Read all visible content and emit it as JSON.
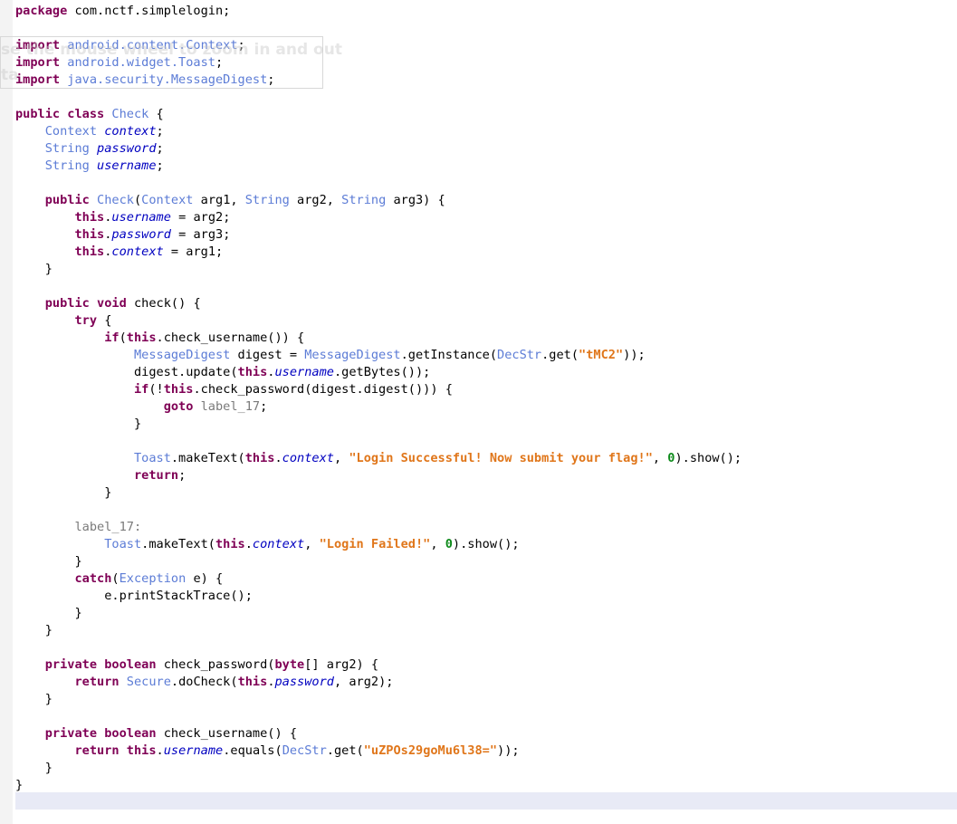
{
  "editor": {
    "tooltip": {
      "line1": "se the mouse wheel to zoom in and out",
      "line2": "ta"
    },
    "lines": [
      [
        {
          "t": "kw",
          "v": "package"
        },
        {
          "t": "plain",
          "v": " com.nctf.simplelogin;"
        }
      ],
      [],
      [
        {
          "t": "kw",
          "v": "import"
        },
        {
          "t": "type",
          "v": " android.content.Context"
        },
        {
          "t": "plain",
          "v": ";"
        }
      ],
      [
        {
          "t": "kw",
          "v": "import"
        },
        {
          "t": "type",
          "v": " android.widget.Toast"
        },
        {
          "t": "plain",
          "v": ";"
        }
      ],
      [
        {
          "t": "kw",
          "v": "import"
        },
        {
          "t": "type",
          "v": " java.security.MessageDigest"
        },
        {
          "t": "plain",
          "v": ";"
        }
      ],
      [],
      [
        {
          "t": "kw",
          "v": "public class"
        },
        {
          "t": "plain",
          "v": " "
        },
        {
          "t": "type",
          "v": "Check"
        },
        {
          "t": "plain",
          "v": " {"
        }
      ],
      [
        {
          "t": "plain",
          "v": "    "
        },
        {
          "t": "type",
          "v": "Context"
        },
        {
          "t": "plain",
          "v": " "
        },
        {
          "t": "field",
          "v": "context"
        },
        {
          "t": "plain",
          "v": ";"
        }
      ],
      [
        {
          "t": "plain",
          "v": "    "
        },
        {
          "t": "type",
          "v": "String"
        },
        {
          "t": "plain",
          "v": " "
        },
        {
          "t": "field",
          "v": "password"
        },
        {
          "t": "plain",
          "v": ";"
        }
      ],
      [
        {
          "t": "plain",
          "v": "    "
        },
        {
          "t": "type",
          "v": "String"
        },
        {
          "t": "plain",
          "v": " "
        },
        {
          "t": "field",
          "v": "username"
        },
        {
          "t": "plain",
          "v": ";"
        }
      ],
      [],
      [
        {
          "t": "plain",
          "v": "    "
        },
        {
          "t": "kw",
          "v": "public"
        },
        {
          "t": "plain",
          "v": " "
        },
        {
          "t": "type",
          "v": "Check"
        },
        {
          "t": "plain",
          "v": "("
        },
        {
          "t": "type",
          "v": "Context"
        },
        {
          "t": "plain",
          "v": " arg1, "
        },
        {
          "t": "type",
          "v": "String"
        },
        {
          "t": "plain",
          "v": " arg2, "
        },
        {
          "t": "type",
          "v": "String"
        },
        {
          "t": "plain",
          "v": " arg3) {"
        }
      ],
      [
        {
          "t": "plain",
          "v": "        "
        },
        {
          "t": "kw",
          "v": "this"
        },
        {
          "t": "plain",
          "v": "."
        },
        {
          "t": "field",
          "v": "username"
        },
        {
          "t": "plain",
          "v": " = arg2;"
        }
      ],
      [
        {
          "t": "plain",
          "v": "        "
        },
        {
          "t": "kw",
          "v": "this"
        },
        {
          "t": "plain",
          "v": "."
        },
        {
          "t": "field",
          "v": "password"
        },
        {
          "t": "plain",
          "v": " = arg3;"
        }
      ],
      [
        {
          "t": "plain",
          "v": "        "
        },
        {
          "t": "kw",
          "v": "this"
        },
        {
          "t": "plain",
          "v": "."
        },
        {
          "t": "field",
          "v": "context"
        },
        {
          "t": "plain",
          "v": " = arg1;"
        }
      ],
      [
        {
          "t": "plain",
          "v": "    }"
        }
      ],
      [],
      [
        {
          "t": "plain",
          "v": "    "
        },
        {
          "t": "kw",
          "v": "public void"
        },
        {
          "t": "plain",
          "v": " check() {"
        }
      ],
      [
        {
          "t": "plain",
          "v": "        "
        },
        {
          "t": "kw",
          "v": "try"
        },
        {
          "t": "plain",
          "v": " {"
        }
      ],
      [
        {
          "t": "plain",
          "v": "            "
        },
        {
          "t": "kw",
          "v": "if"
        },
        {
          "t": "plain",
          "v": "("
        },
        {
          "t": "kw",
          "v": "this"
        },
        {
          "t": "plain",
          "v": ".check_username()) {"
        }
      ],
      [
        {
          "t": "plain",
          "v": "                "
        },
        {
          "t": "type",
          "v": "MessageDigest"
        },
        {
          "t": "plain",
          "v": " digest = "
        },
        {
          "t": "type",
          "v": "MessageDigest"
        },
        {
          "t": "plain",
          "v": ".getInstance("
        },
        {
          "t": "type",
          "v": "DecStr"
        },
        {
          "t": "plain",
          "v": ".get("
        },
        {
          "t": "str",
          "v": "\"tMC2\""
        },
        {
          "t": "plain",
          "v": "));"
        }
      ],
      [
        {
          "t": "plain",
          "v": "                digest.update("
        },
        {
          "t": "kw",
          "v": "this"
        },
        {
          "t": "plain",
          "v": "."
        },
        {
          "t": "field",
          "v": "username"
        },
        {
          "t": "plain",
          "v": ".getBytes());"
        }
      ],
      [
        {
          "t": "plain",
          "v": "                "
        },
        {
          "t": "kw",
          "v": "if"
        },
        {
          "t": "plain",
          "v": "(!"
        },
        {
          "t": "kw",
          "v": "this"
        },
        {
          "t": "plain",
          "v": ".check_password(digest.digest())) {"
        }
      ],
      [
        {
          "t": "plain",
          "v": "                    "
        },
        {
          "t": "kw",
          "v": "goto"
        },
        {
          "t": "plain",
          "v": " "
        },
        {
          "t": "label",
          "v": "label_17"
        },
        {
          "t": "plain",
          "v": ";"
        }
      ],
      [
        {
          "t": "plain",
          "v": "                }"
        }
      ],
      [],
      [
        {
          "t": "plain",
          "v": "                "
        },
        {
          "t": "type",
          "v": "Toast"
        },
        {
          "t": "plain",
          "v": ".makeText("
        },
        {
          "t": "kw",
          "v": "this"
        },
        {
          "t": "plain",
          "v": "."
        },
        {
          "t": "field",
          "v": "context"
        },
        {
          "t": "plain",
          "v": ", "
        },
        {
          "t": "str",
          "v": "\"Login Successful! Now submit your flag!\""
        },
        {
          "t": "plain",
          "v": ", "
        },
        {
          "t": "num",
          "v": "0"
        },
        {
          "t": "plain",
          "v": ").show();"
        }
      ],
      [
        {
          "t": "plain",
          "v": "                "
        },
        {
          "t": "kw",
          "v": "return"
        },
        {
          "t": "plain",
          "v": ";"
        }
      ],
      [
        {
          "t": "plain",
          "v": "            }"
        }
      ],
      [],
      [
        {
          "t": "plain",
          "v": "        "
        },
        {
          "t": "label",
          "v": "label_17:"
        }
      ],
      [
        {
          "t": "plain",
          "v": "            "
        },
        {
          "t": "type",
          "v": "Toast"
        },
        {
          "t": "plain",
          "v": ".makeText("
        },
        {
          "t": "kw",
          "v": "this"
        },
        {
          "t": "plain",
          "v": "."
        },
        {
          "t": "field",
          "v": "context"
        },
        {
          "t": "plain",
          "v": ", "
        },
        {
          "t": "str",
          "v": "\"Login Failed!\""
        },
        {
          "t": "plain",
          "v": ", "
        },
        {
          "t": "num",
          "v": "0"
        },
        {
          "t": "plain",
          "v": ").show();"
        }
      ],
      [
        {
          "t": "plain",
          "v": "        }"
        }
      ],
      [
        {
          "t": "plain",
          "v": "        "
        },
        {
          "t": "kw",
          "v": "catch"
        },
        {
          "t": "plain",
          "v": "("
        },
        {
          "t": "type",
          "v": "Exception"
        },
        {
          "t": "plain",
          "v": " e) {"
        }
      ],
      [
        {
          "t": "plain",
          "v": "            e.printStackTrace();"
        }
      ],
      [
        {
          "t": "plain",
          "v": "        }"
        }
      ],
      [
        {
          "t": "plain",
          "v": "    }"
        }
      ],
      [],
      [
        {
          "t": "plain",
          "v": "    "
        },
        {
          "t": "kw",
          "v": "private boolean"
        },
        {
          "t": "plain",
          "v": " check_password("
        },
        {
          "t": "kw",
          "v": "byte"
        },
        {
          "t": "plain",
          "v": "[] arg2) {"
        }
      ],
      [
        {
          "t": "plain",
          "v": "        "
        },
        {
          "t": "kw",
          "v": "return"
        },
        {
          "t": "plain",
          "v": " "
        },
        {
          "t": "type",
          "v": "Secure"
        },
        {
          "t": "plain",
          "v": ".doCheck("
        },
        {
          "t": "kw",
          "v": "this"
        },
        {
          "t": "plain",
          "v": "."
        },
        {
          "t": "field",
          "v": "password"
        },
        {
          "t": "plain",
          "v": ", arg2);"
        }
      ],
      [
        {
          "t": "plain",
          "v": "    }"
        }
      ],
      [],
      [
        {
          "t": "plain",
          "v": "    "
        },
        {
          "t": "kw",
          "v": "private boolean"
        },
        {
          "t": "plain",
          "v": " check_username() {"
        }
      ],
      [
        {
          "t": "plain",
          "v": "        "
        },
        {
          "t": "kw",
          "v": "return"
        },
        {
          "t": "plain",
          "v": " "
        },
        {
          "t": "kw",
          "v": "this"
        },
        {
          "t": "plain",
          "v": "."
        },
        {
          "t": "field",
          "v": "username"
        },
        {
          "t": "plain",
          "v": ".equals("
        },
        {
          "t": "type",
          "v": "DecStr"
        },
        {
          "t": "plain",
          "v": ".get("
        },
        {
          "t": "str",
          "v": "\"uZPOs29goMu6l38=\""
        },
        {
          "t": "plain",
          "v": "));"
        }
      ],
      [
        {
          "t": "plain",
          "v": "    }"
        }
      ],
      [
        {
          "t": "plain",
          "v": "}"
        }
      ],
      []
    ]
  }
}
